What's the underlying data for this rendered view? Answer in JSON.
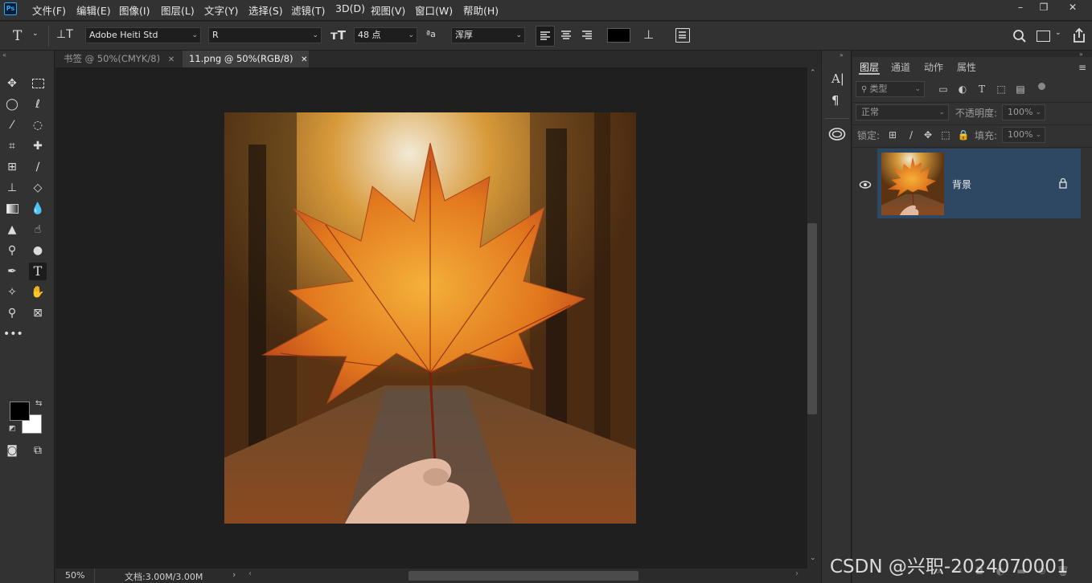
{
  "app": {
    "logo": "Ps"
  },
  "menu": [
    "文件(F)",
    "编辑(E)",
    "图像(I)",
    "图层(L)",
    "文字(Y)",
    "选择(S)",
    "滤镜(T)",
    "3D(D)",
    "视图(V)",
    "窗口(W)",
    "帮助(H)"
  ],
  "window_controls": {
    "minimize": "–",
    "restore": "❐",
    "close": "✕"
  },
  "options": {
    "font_family": "Adobe Heiti Std",
    "font_style": "R",
    "font_size": "48 点",
    "aa_label": "ªa",
    "antialias": "浑厚",
    "text_color": "#000000"
  },
  "tabs": [
    {
      "label": "书签 @ 50%(CMYK/8)",
      "close": "✕"
    },
    {
      "label": "11.png @ 50%(RGB/8)",
      "close": "✕"
    }
  ],
  "colors": {
    "foreground": "#000000",
    "background": "#ffffff",
    "accent": "#31a8ff",
    "layer_selected": "#2e4863"
  },
  "status": {
    "zoom": "50%",
    "doc_info": "文档:3.00M/3.00M",
    "arrow": "›"
  },
  "panel": {
    "tabs": [
      "图层",
      "通道",
      "动作",
      "属性"
    ],
    "filter_label": "类型",
    "blend_mode": "正常",
    "opacity_label": "不透明度:",
    "opacity_value": "100%",
    "lock_label": "锁定:",
    "fill_label": "填充:",
    "fill_value": "100%",
    "layers": [
      {
        "name": "背景",
        "visible": true,
        "locked": true
      }
    ]
  },
  "watermark": "CSDN @兴职-2024070001"
}
